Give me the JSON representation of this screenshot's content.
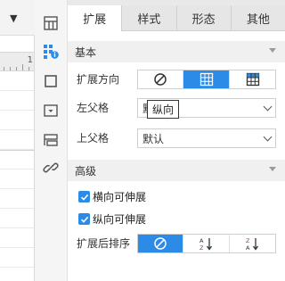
{
  "left_pane": {
    "indicator": "▼",
    "ruler_number": "1"
  },
  "icon_bar": {
    "items": [
      {
        "name": "cell-structure-icon"
      },
      {
        "name": "cell-attr-icon",
        "active": true
      },
      {
        "name": "border-icon"
      },
      {
        "name": "dropdown-widget-icon"
      },
      {
        "name": "layout-icon"
      },
      {
        "name": "link-icon"
      }
    ]
  },
  "panel": {
    "tabs": [
      {
        "label": "扩展",
        "active": true
      },
      {
        "label": "样式"
      },
      {
        "label": "形态"
      },
      {
        "label": "其他"
      }
    ],
    "basic": {
      "header": "基本",
      "direction_label": "扩展方向",
      "direction_options": [
        "none",
        "vertical",
        "horizontal"
      ],
      "direction_selected": 1,
      "left_parent_label": "左父格",
      "left_parent_value": "默认",
      "tooltip": "纵向",
      "top_parent_label": "上父格",
      "top_parent_value": "默认"
    },
    "advanced": {
      "header": "高级",
      "horizontal_expand_label": "横向可伸展",
      "vertical_expand_label": "纵向可伸展",
      "sort_label": "扩展后排序",
      "sort_options": [
        "none",
        "ascending",
        "descending"
      ],
      "sort_selected": 0
    }
  },
  "colors": {
    "accent": "#2b8be6",
    "section_bg": "#f0f0f0",
    "tab_bg": "#e6e6e6"
  }
}
